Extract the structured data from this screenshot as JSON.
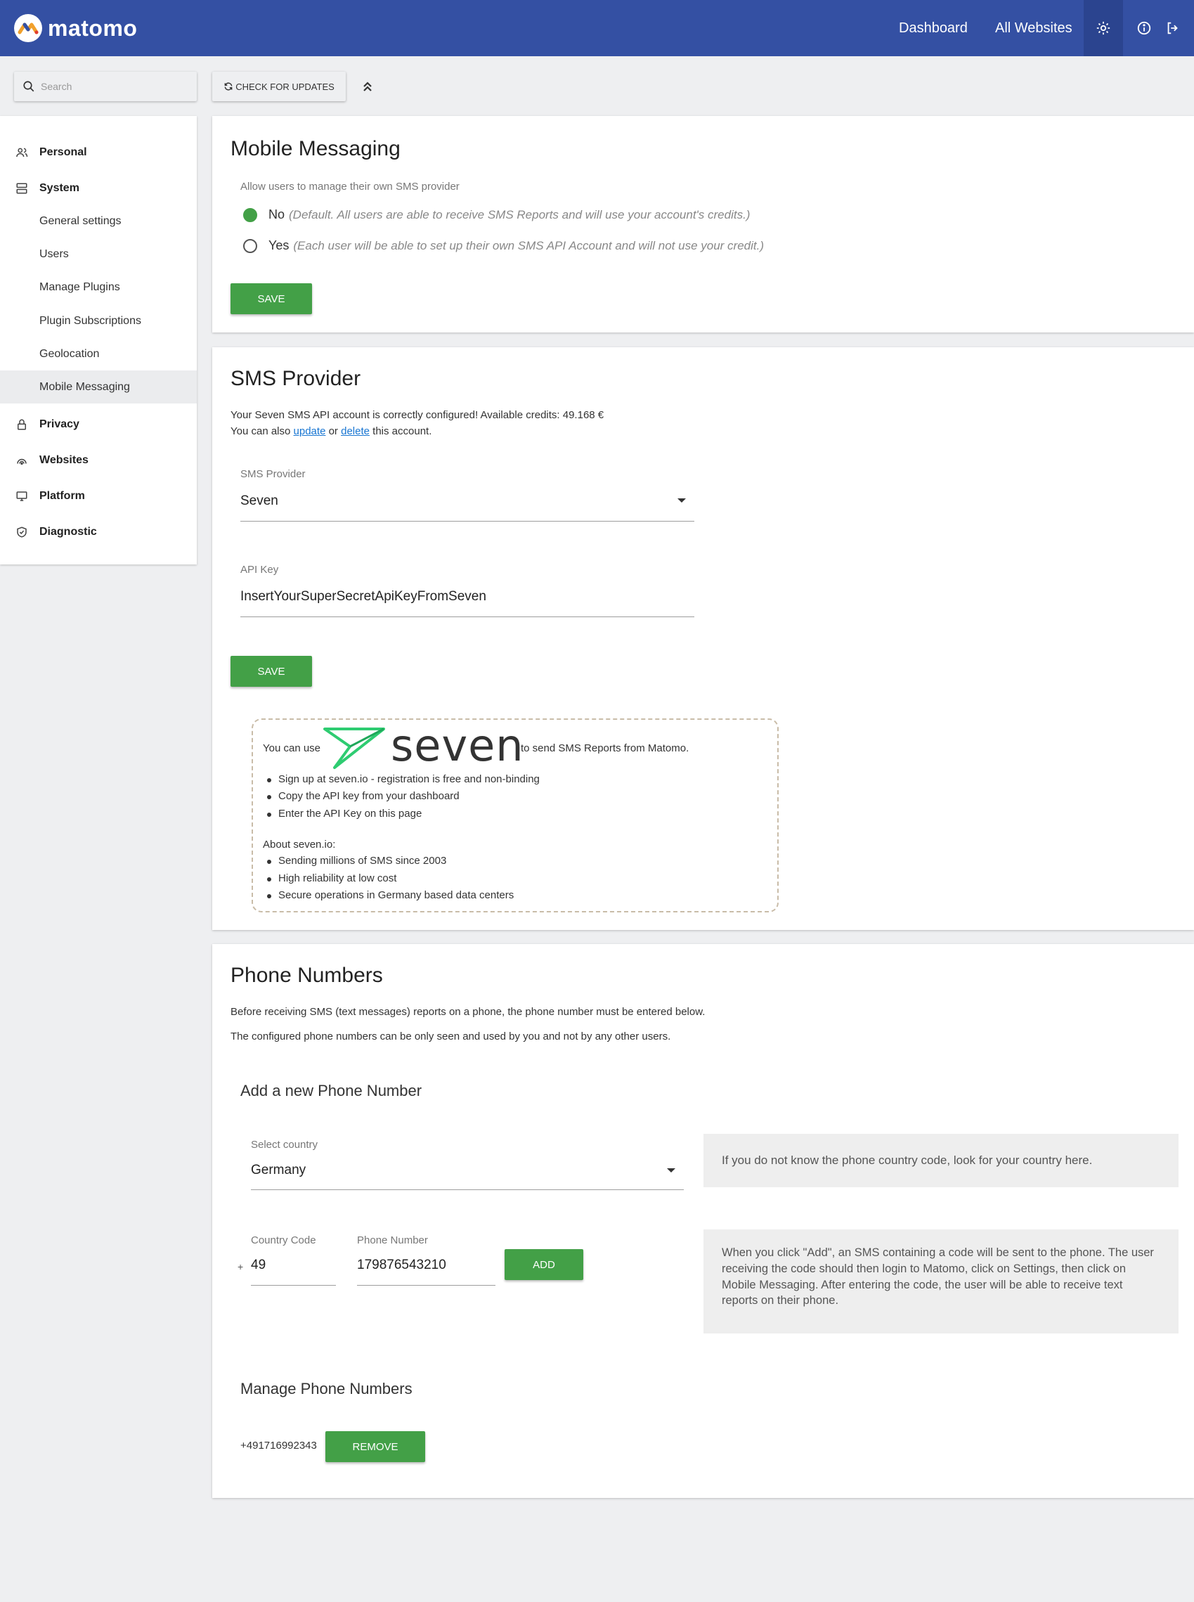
{
  "header": {
    "logo_text": "matomo",
    "nav_dashboard": "Dashboard",
    "nav_all_websites": "All Websites",
    "brand_color": "#3450a3"
  },
  "search": {
    "placeholder": "Search"
  },
  "toolbar": {
    "check_updates": "CHECK FOR UPDATES"
  },
  "menu": {
    "personal": "Personal",
    "system": "System",
    "system_items": [
      "General settings",
      "Users",
      "Manage Plugins",
      "Plugin Subscriptions",
      "Geolocation",
      "Mobile Messaging"
    ],
    "active_item": "Mobile Messaging",
    "privacy": "Privacy",
    "websites": "Websites",
    "platform": "Platform",
    "diagnostic": "Diagnostic"
  },
  "mobile_messaging": {
    "title": "Mobile Messaging",
    "setting_label": "Allow users to manage their own SMS provider",
    "option_no_label": "No",
    "option_no_help": "(Default. All users are able to receive SMS Reports and will use your account's credits.)",
    "option_yes_label": "Yes",
    "option_yes_help": "(Each user will be able to set up their own SMS API Account and will not use your credit.)",
    "selected": "No",
    "save": "SAVE"
  },
  "sms_provider": {
    "title": "SMS Provider",
    "status_line": "Your Seven SMS API account is correctly configured! Available credits: 49.168 €",
    "also_prefix": "You can also",
    "update_link": "update",
    "or": "or",
    "delete_link": "delete",
    "also_suffix": "this account.",
    "provider_label": "SMS Provider",
    "provider_value": "Seven",
    "api_key_label": "API Key",
    "api_key_value": "InsertYourSuperSecretApiKeyFromSeven",
    "save": "SAVE",
    "promo": {
      "prefix": "You can use",
      "logo_text": "seven",
      "suffix": "to send SMS Reports from Matomo.",
      "steps": [
        "Sign up at seven.io - registration is free and non-binding",
        "Copy the API key from your dashboard",
        "Enter the API Key on this page"
      ],
      "about_title": "About seven.io:",
      "about_items": [
        "Sending millions of SMS since 2003",
        "High reliability at low cost",
        "Secure operations in Germany based data centers"
      ],
      "logo_color": "#2ecc71"
    }
  },
  "phone_numbers": {
    "title": "Phone Numbers",
    "intro_1": "Before receiving SMS (text messages) reports on a phone, the phone number must be entered below.",
    "intro_2": "The configured phone numbers can be only seen and used by you and not by any other users.",
    "add_title": "Add a new Phone Number",
    "country_label": "Select country",
    "country_value": "Germany",
    "country_help": "If you do not know the phone country code, look for your country here.",
    "code_label": "Country Code",
    "code_prefix": "+",
    "code_value": "49",
    "number_label": "Phone Number",
    "number_value": "179876543210",
    "add": "ADD",
    "add_help": "When you click \"Add\", an SMS containing a code will be sent to the phone. The user receiving the code should then login to Matomo, click on Settings, then click on Mobile Messaging. After entering the code, the user will be able to receive text reports on their phone.",
    "manage_title": "Manage Phone Numbers",
    "existing_number": "+491716992343",
    "remove": "REMOVE"
  }
}
